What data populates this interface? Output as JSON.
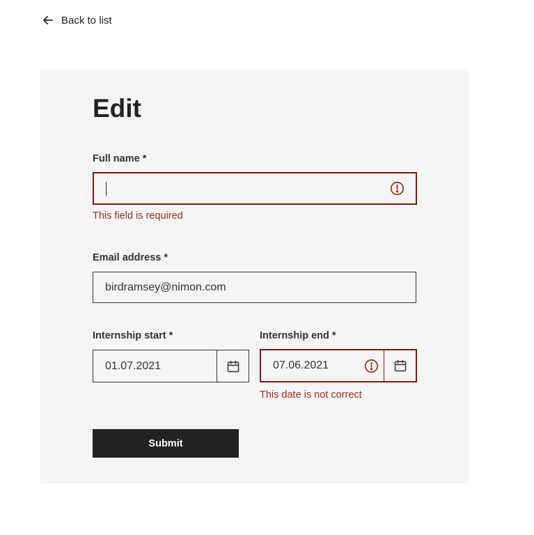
{
  "nav": {
    "back_label": "Back to list"
  },
  "form": {
    "title": "Edit",
    "full_name": {
      "label": "Full name *",
      "value": "",
      "error": "This field is required"
    },
    "email": {
      "label": "Email address *",
      "value": "birdramsey@nimon.com"
    },
    "internship_start": {
      "label": "Internship start *",
      "value": "01.07.2021"
    },
    "internship_end": {
      "label": "Internship end *",
      "value": "07.06.2021",
      "error": "This date is not correct"
    },
    "submit_label": "Submit"
  },
  "colors": {
    "background": "#ffffff",
    "card": "#f5f5f5",
    "error": "#7a1c0c",
    "error_text": "#9b2c1c",
    "button": "#222222"
  },
  "icons": {
    "back": "arrow-left-icon",
    "error": "alert-circle-icon",
    "calendar": "calendar-icon"
  }
}
